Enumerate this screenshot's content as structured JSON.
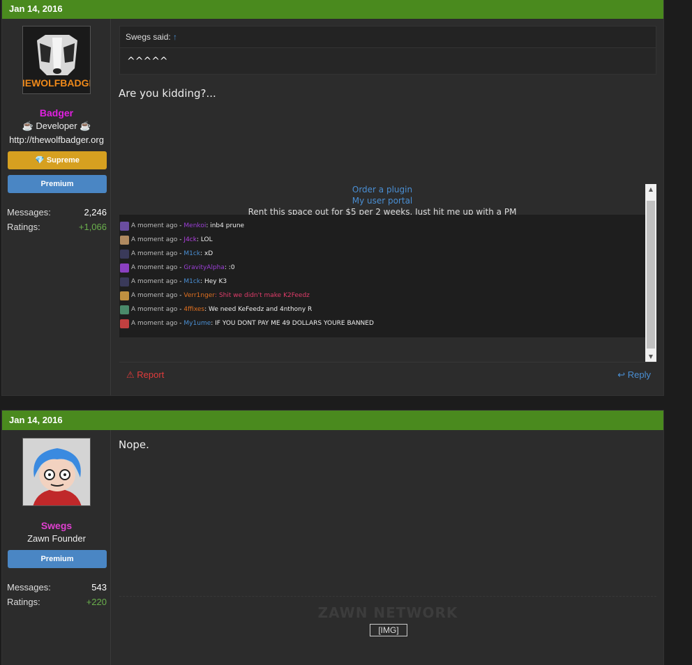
{
  "posts": [
    {
      "date": "Jan 14, 2016",
      "user": {
        "name": "Badger",
        "name_color": "#e020e0",
        "title": "Developer",
        "website": "http://thewolfbadger.org",
        "avatar_text": "THEWOLFBADGER"
      },
      "badges": [
        {
          "label": "Supreme",
          "color": "#d6a020"
        },
        {
          "label": "Premium",
          "color": "#4a86c4"
        }
      ],
      "stats": {
        "messages_label": "Messages:",
        "messages": "2,246",
        "ratings_label": "Ratings:",
        "ratings": "+1,066"
      },
      "quote": {
        "author": "Swegs said:",
        "arrow": "↑",
        "text": "^^^^^"
      },
      "message": "Are you kidding?...",
      "ad": {
        "link1": "Order a plugin",
        "link2": "My user portal",
        "rent": "Rent this space out for $5 per 2 weeks. Just hit me up with a PM"
      },
      "shoutbox": [
        {
          "time": "A moment ago",
          "sep": " - ",
          "user": "Menkoi",
          "user_color": "#9b3fd6",
          "text": ": inb4 prune",
          "text_color": "#eeeeee",
          "avatar_color": "#6a4ea0"
        },
        {
          "time": "A moment ago",
          "sep": " - ",
          "user": "J4ck",
          "user_color": "#b040e0",
          "text": ": LOL",
          "text_color": "#eeeeee",
          "avatar_color": "#b08a60"
        },
        {
          "time": "A moment ago",
          "sep": " - ",
          "user": "M1ck",
          "user_color": "#4a8fd4",
          "text": ": xD",
          "text_color": "#eeeeee",
          "avatar_color": "#3a3a5a"
        },
        {
          "time": "A moment ago",
          "sep": " - ",
          "user": "GravityAlpha",
          "user_color": "#9b3fd6",
          "text": ": :0",
          "text_color": "#eeeeee",
          "avatar_color": "#8a40c0"
        },
        {
          "time": "A moment ago",
          "sep": " - ",
          "user": "M1ck",
          "user_color": "#4a8fd4",
          "text": ": Hey K3",
          "text_color": "#eeeeee",
          "avatar_color": "#3a3a5a"
        },
        {
          "time": "A moment ago",
          "sep": " - ",
          "user": "Verr1nger",
          "user_color": "#e07020",
          "text": ": Shit we didn't make K2Feedz",
          "text_color": "#e03c6a",
          "avatar_color": "#c09040"
        },
        {
          "time": "A moment ago",
          "sep": " - ",
          "user": "4ffixes",
          "user_color": "#e07020",
          "text": ": We need KeFeedz and 4nthony R",
          "text_color": "#eeeeee",
          "avatar_color": "#4a8a6a"
        },
        {
          "time": "A moment ago",
          "sep": " - ",
          "user": "My1ume",
          "user_color": "#4a8fd4",
          "text": ": IF YOU DONT PAY ME 49 DOLLARS YOURE BANNED",
          "text_color": "#eeeeee",
          "avatar_color": "#c04040"
        }
      ],
      "actions": {
        "report": "Report",
        "reply": "Reply"
      }
    },
    {
      "date": "Jan 14, 2016",
      "user": {
        "name": "Swegs",
        "name_color": "#e040d0",
        "title": "Zawn Founder"
      },
      "badges": [
        {
          "label": "Premium",
          "color": "#4a86c4"
        }
      ],
      "stats": {
        "messages_label": "Messages:",
        "messages": "543",
        "ratings_label": "Ratings:",
        "ratings": "+220"
      },
      "message": "Nope.",
      "signature": {
        "network": "ZAWN NETWORK",
        "img_alt": "[IMG]"
      }
    }
  ],
  "colors": {
    "header_green": "#4a8a1e",
    "link_blue": "#4a8fd4",
    "ratings_green": "#6ab04c",
    "report_red": "#e03c3c"
  }
}
